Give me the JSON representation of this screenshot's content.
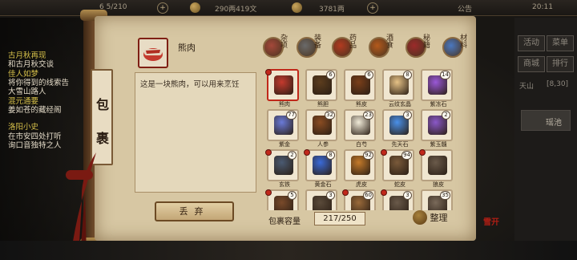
{
  "topbar": {
    "level": "6 5/210",
    "silver": "290两419文",
    "gold": "3781两",
    "announce": "公告",
    "time": "20:11"
  },
  "quests": [
    {
      "title": "古月秋再现",
      "desc": "和古月秋交谈"
    },
    {
      "title": "佳人如梦",
      "desc": "将你得到的线索告",
      "desc2": "大雪山路人"
    },
    {
      "title": "混元通要",
      "desc": "姜如苍的藏经阁"
    },
    {
      "title": "洛阳小史",
      "desc": "在市安四处打听",
      "desc2": "询口音独特之人"
    }
  ],
  "right_panel": {
    "btn1": "活动",
    "btn2": "菜单",
    "btn3": "商城",
    "btn4": "排行",
    "location": "天山",
    "coords": "[8,30]",
    "area": "瑶池"
  },
  "bag": {
    "title": "包裹",
    "selected_name": "熊肉",
    "description": "这是一块熊肉，可以用来烹饪",
    "discard": "丢弃",
    "capacity_label": "包裹容量",
    "capacity_value": "217/250",
    "sort": "整理",
    "seal": "雪开"
  },
  "tabs": [
    {
      "label": "杂项",
      "color": "#a4483a"
    },
    {
      "label": "装备",
      "color": "#6a6a6a"
    },
    {
      "label": "药品",
      "color": "#b23a20"
    },
    {
      "label": "酒食",
      "color": "#b45a1c"
    },
    {
      "label": "秘籍",
      "color": "#9c2a2a"
    },
    {
      "label": "材料",
      "color": "#4a78c0"
    }
  ],
  "items": [
    {
      "name": "熊肉",
      "count": "",
      "color": "#c43a2e",
      "sel": true,
      "dot": true
    },
    {
      "name": "熊胆",
      "count": "6",
      "color": "#5c3d1e"
    },
    {
      "name": "熊皮",
      "count": "6",
      "color": "#7a3f1a"
    },
    {
      "name": "云纹玄晶",
      "count": "8",
      "color": "#e6c286"
    },
    {
      "name": "紫冻石",
      "count": "14",
      "color": "#9a58d8"
    },
    {
      "name": "紫金",
      "count": "77",
      "color": "#6a7ad8"
    },
    {
      "name": "人参",
      "count": "32",
      "color": "#8a4c22"
    },
    {
      "name": "白芍",
      "count": "23",
      "color": "#f0ead8"
    },
    {
      "name": "先天石",
      "count": "3",
      "color": "#4a90e8"
    },
    {
      "name": "紫玉髓",
      "count": "2",
      "color": "#8a58c8"
    },
    {
      "name": "玄铁",
      "count": "2",
      "color": "#4a5a72",
      "dot": true
    },
    {
      "name": "黄金石",
      "count": "8",
      "color": "#3a6ad8",
      "dot": true
    },
    {
      "name": "虎皮",
      "count": "92",
      "color": "#c47a2a"
    },
    {
      "name": "蛇皮",
      "count": "94",
      "color": "#7a5a3a",
      "dot": true
    },
    {
      "name": "狼皮",
      "count": "",
      "color": "#6a5a4a",
      "dot": true
    },
    {
      "name": "",
      "count": "5",
      "color": "#7a4a2a",
      "dot": true
    },
    {
      "name": "",
      "count": "3",
      "color": "#5a4a3a"
    },
    {
      "name": "",
      "count": "60",
      "color": "#9a6a3a",
      "dot": true
    },
    {
      "name": "",
      "count": "3",
      "color": "#6a5a4a",
      "dot": true
    },
    {
      "name": "",
      "count": "35",
      "color": "#7a6a5a"
    }
  ]
}
